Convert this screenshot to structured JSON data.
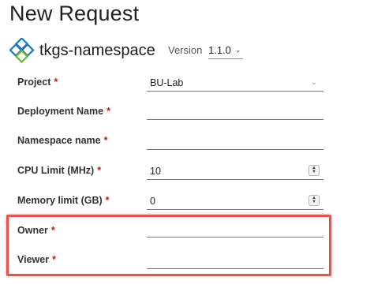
{
  "page": {
    "title": "New Request"
  },
  "catalog": {
    "name": "tkgs-namespace",
    "icon": "cubes-icon"
  },
  "version": {
    "label": "Version",
    "value": "1.1.0"
  },
  "form": {
    "project": {
      "label": "Project",
      "required": "*",
      "value": "BU-Lab"
    },
    "deployment_name": {
      "label": "Deployment Name",
      "required": "*",
      "value": ""
    },
    "namespace_name": {
      "label": "Namespace name",
      "required": "*",
      "value": ""
    },
    "cpu_limit": {
      "label": "CPU Limit (MHz)",
      "required": "*",
      "value": "10"
    },
    "memory_limit": {
      "label": "Memory limit (GB)",
      "required": "*",
      "value": "0"
    },
    "owner": {
      "label": "Owner",
      "required": "*",
      "value": ""
    },
    "viewer": {
      "label": "Viewer",
      "required": "*",
      "value": ""
    }
  },
  "colors": {
    "highlight": "#e8544a",
    "required": "#c21d00",
    "icon_blue": "#1a7ab8",
    "icon_green": "#6bb43f"
  }
}
